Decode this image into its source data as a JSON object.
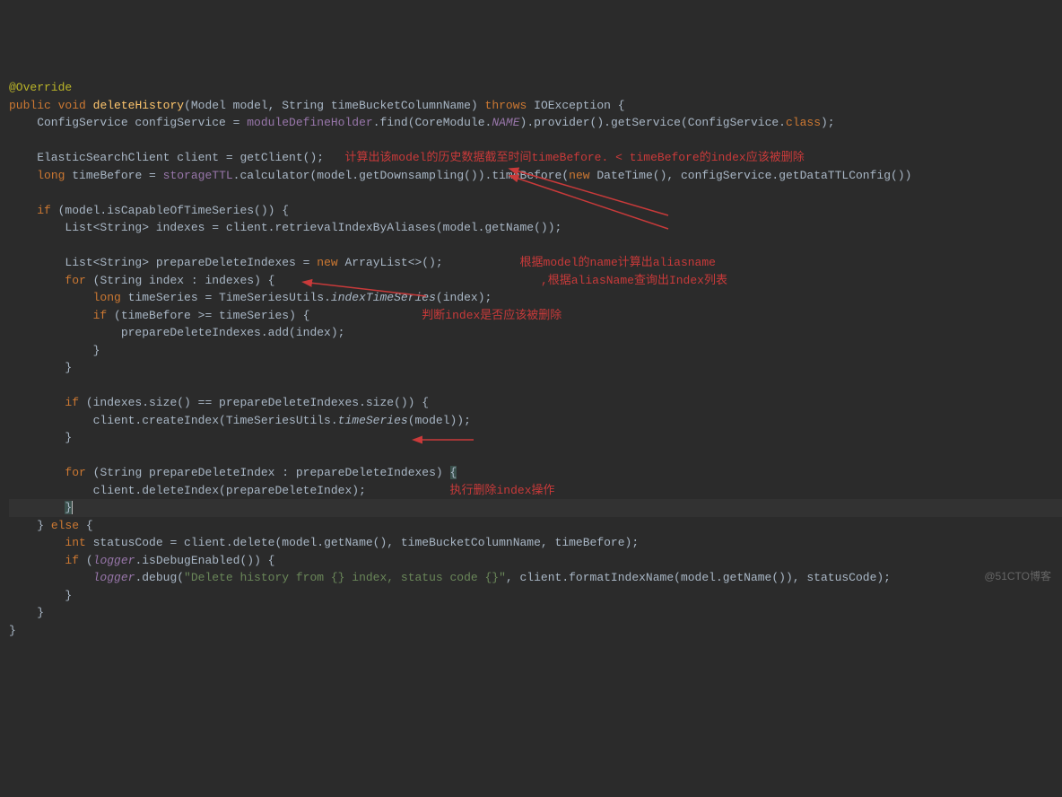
{
  "code": {
    "l1": "@Override",
    "l2_kw1": "public void",
    "l2_method": "deleteHistory",
    "l2_params": "(Model model, String timeBucketColumnName)",
    "l2_kw2": " throws ",
    "l2_rest": "IOException {",
    "l3_a": "    ConfigService configService = ",
    "l3_b": "moduleDefineHolder",
    "l3_c": ".find(CoreModule.",
    "l3_d": "NAME",
    "l3_e": ").provider().getService(ConfigService.",
    "l3_f": "class",
    "l3_g": ");",
    "l5_a": "    ElasticSearchClient client = getClient();",
    "l6_a": "    ",
    "l6_kw": "long",
    "l6_b": " timeBefore = ",
    "l6_c": "storageTTL",
    "l6_d": ".calculator(model.getDownsampling()).timeBefore(",
    "l6_kw2": "new ",
    "l6_e": "DateTime(), configService.getDataTTLConfig())",
    "l8_a": "    ",
    "l8_kw": "if ",
    "l8_b": "(model.isCapableOfTimeSeries()) {",
    "l9_a": "        List<String> indexes = client.retrievalIndexByAliases(model.getName());",
    "l11_a": "        List<String> prepareDeleteIndexes = ",
    "l11_kw": "new ",
    "l11_b": "ArrayList<>();",
    "l12_a": "        ",
    "l12_kw": "for ",
    "l12_b": "(String index : indexes) {",
    "l13_a": "            ",
    "l13_kw": "long",
    "l13_b": " timeSeries = TimeSeriesUtils.",
    "l13_c": "indexTimeSeries",
    "l13_d": "(index);",
    "l14_a": "            ",
    "l14_kw": "if ",
    "l14_b": "(timeBefore >= timeSeries) {",
    "l15_a": "                prepareDeleteIndexes.add(index);",
    "l16_a": "            }",
    "l17_a": "        }",
    "l19_a": "        ",
    "l19_kw": "if ",
    "l19_b": "(indexes.size() == prepareDeleteIndexes.size()) {",
    "l20_a": "            client.createIndex(TimeSeriesUtils.",
    "l20_b": "timeSeries",
    "l20_c": "(model));",
    "l21_a": "        }",
    "l23_a": "        ",
    "l23_kw": "for ",
    "l23_b": "(String prepareDeleteIndex : prepareDeleteIndexes) ",
    "l23_c": "{",
    "l24_a": "            client.deleteIndex(prepareDeleteIndex);",
    "l25_a": "        ",
    "l25_b": "}",
    "l26_a": "    } ",
    "l26_kw": "else ",
    "l26_b": "{",
    "l27_a": "        ",
    "l27_kw": "int",
    "l27_b": " statusCode = client.delete(model.getName(), timeBucketColumnName, timeBefore);",
    "l28_a": "        ",
    "l28_kw": "if ",
    "l28_b": "(",
    "l28_c": "logger",
    "l28_d": ".isDebugEnabled()) {",
    "l29_a": "            ",
    "l29_b": "logger",
    "l29_c": ".debug(",
    "l29_d": "\"Delete history from {} index, status code {}\"",
    "l29_e": ", client.formatIndexName(model.getName()), statusCode);",
    "l30_a": "        }",
    "l31_a": "    }",
    "l32_a": "}"
  },
  "notes": {
    "n1": "计算出该model的历史数据截至时间timeBefore. < timeBefore的index应该被删除",
    "n2a": "根据model的name计算出aliasname",
    "n2b": ",根据aliasName查询出Index列表",
    "n3": "判断index是否应该被删除",
    "n4": "执行删除index操作"
  },
  "watermark": "@51CTO博客"
}
